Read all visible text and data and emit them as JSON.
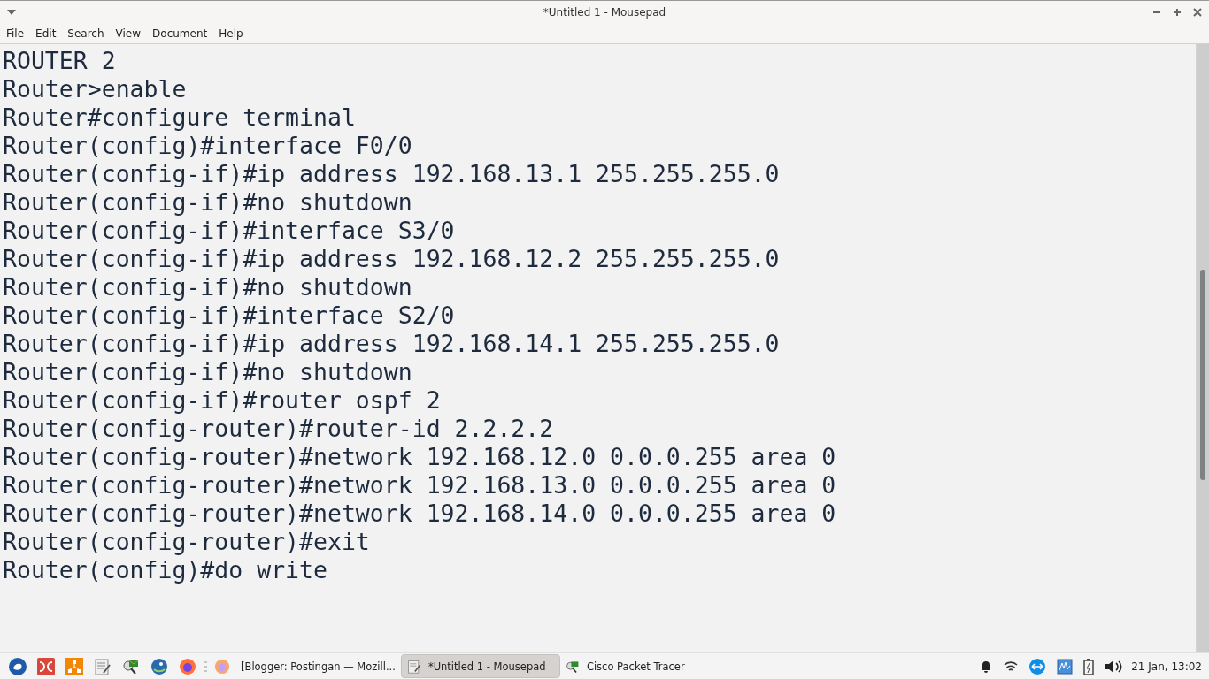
{
  "window": {
    "title": "*Untitled 1 - Mousepad"
  },
  "menu": [
    "File",
    "Edit",
    "Search",
    "View",
    "Document",
    "Help"
  ],
  "editor": {
    "lines": [
      "ROUTER 2",
      "Router>enable",
      "Router#configure terminal",
      "Router(config)#interface F0/0",
      "Router(config-if)#ip address 192.168.13.1 255.255.255.0",
      "Router(config-if)#no shutdown",
      "Router(config-if)#interface S3/0",
      "Router(config-if)#ip address 192.168.12.2 255.255.255.0",
      "Router(config-if)#no shutdown",
      "Router(config-if)#interface S2/0",
      "Router(config-if)#ip address 192.168.14.1 255.255.255.0",
      "Router(config-if)#no shutdown",
      "Router(config-if)#router ospf 2",
      "Router(config-router)#router-id 2.2.2.2",
      "Router(config-router)#network 192.168.12.0 0.0.0.255 area 0",
      "Router(config-router)#network 192.168.13.0 0.0.0.255 area 0",
      "Router(config-router)#network 192.168.14.0 0.0.0.255 area 0",
      "Router(config-router)#exit",
      "Router(config)#do write"
    ]
  },
  "taskbar": {
    "tasks": [
      {
        "label": "[Blogger: Postingan — Mozill...",
        "kind": "browser",
        "selected": false
      },
      {
        "label": "*Untitled 1 - Mousepad",
        "kind": "editor",
        "selected": true
      },
      {
        "label": "Cisco Packet Tracer",
        "kind": "tracer",
        "selected": false
      }
    ],
    "clock": "21 Jan, 13:02"
  }
}
